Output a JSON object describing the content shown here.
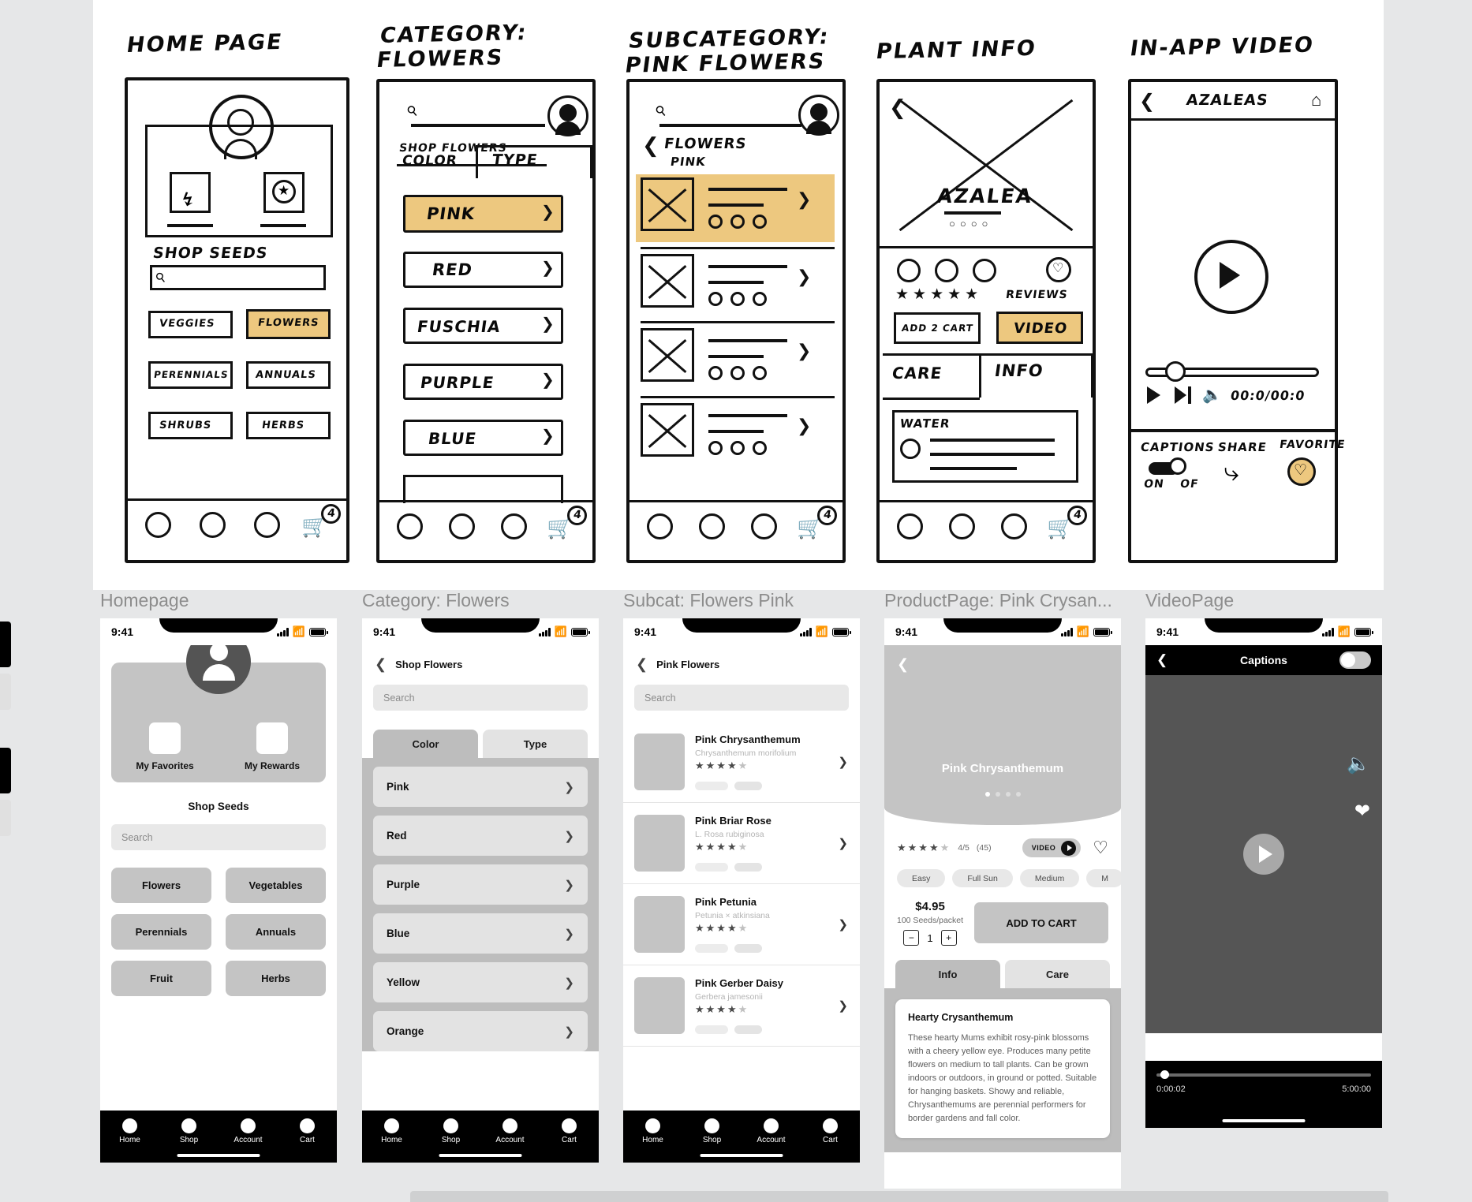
{
  "sketches": [
    {
      "title": "HOME PAGE",
      "labels": [
        "SHOP SEEDS",
        "VEGGIES",
        "FLOWERS",
        "PERENNIALS",
        "ANNUALS",
        "SHRUBS",
        "HERBS"
      ],
      "highlighted": "FLOWERS",
      "cart_badge": "4"
    },
    {
      "title": "CATEGORY:\nFLOWERS",
      "labels": [
        "SHOP FLOWERS",
        "COLOR",
        "TYPE",
        "PINK",
        "RED",
        "FUSCHIA",
        "PURPLE",
        "BLUE"
      ],
      "highlighted": "PINK",
      "cart_badge": "4"
    },
    {
      "title": "SUBCATEGORY:\nPINK FLOWERS",
      "labels": [
        "FLOWERS",
        "PINK"
      ],
      "cart_badge": "4"
    },
    {
      "title": "PLANT INFO",
      "labels": [
        "AZALEA",
        "REVIEWS",
        "ADD 2 CART",
        "VIDEO",
        "CARE",
        "INFO",
        "WATER"
      ],
      "highlighted": "VIDEO",
      "cart_badge": "4"
    },
    {
      "title": "IN-APP VIDEO",
      "labels": [
        "AZALEAS",
        "00:0/00:0",
        "CAPTIONS",
        "ON",
        "OF",
        "SHARE",
        "FAVORITE"
      ]
    }
  ],
  "sketch_text": {
    "home_shop_seeds": "SHOP SEEDS",
    "home_veggies": "VEGGIES",
    "home_flowers": "FLOWERS",
    "home_perennials": "PERENNIALS",
    "home_annuals": "ANNUALS",
    "home_shrubs": "SHRUBS",
    "home_herbs": "HERBS",
    "cat_shop_flowers": "SHOP FLOWERS",
    "cat_color": "COLOR",
    "cat_type": "TYPE",
    "cat_pink": "PINK",
    "cat_red": "RED",
    "cat_fuschia": "FUSCHIA",
    "cat_purple": "PURPLE",
    "cat_blue": "BLUE",
    "sub_flowers": "FLOWERS",
    "sub_pink": "PINK",
    "plant_name": "AZALEA",
    "plant_reviews": "REVIEWS",
    "plant_add_cart": "ADD 2 CART",
    "plant_video": "VIDEO",
    "plant_care": "CARE",
    "plant_info": "INFO",
    "plant_water": "WATER",
    "video_title": "AZALEAS",
    "video_time": "00:0/00:0",
    "video_captions": "CAPTIONS",
    "video_on": "ON",
    "video_of": "OF",
    "video_share": "SHARE",
    "video_favorite": "FAVORITE",
    "cart_badge": "4"
  },
  "mockups": [
    {
      "label": "Homepage",
      "status": {
        "time": "9:41"
      },
      "hero": {
        "tiles": [
          {
            "label": "My Favorites"
          },
          {
            "label": "My Rewards"
          }
        ]
      },
      "section_title": "Shop Seeds",
      "search_placeholder": "Search",
      "categories": [
        "Flowers",
        "Vegetables",
        "Perennials",
        "Annuals",
        "Fruit",
        "Herbs"
      ],
      "tabs": [
        "Home",
        "Shop",
        "Account",
        "Cart"
      ]
    },
    {
      "label": "Category: Flowers",
      "status": {
        "time": "9:41"
      },
      "nav_title": "Shop Flowers",
      "search_placeholder": "Search",
      "segments": [
        {
          "label": "Color",
          "active": true
        },
        {
          "label": "Type",
          "active": false
        }
      ],
      "colors": [
        "Pink",
        "Red",
        "Purple",
        "Blue",
        "Yellow",
        "Orange"
      ],
      "tabs": [
        "Home",
        "Shop",
        "Account",
        "Cart"
      ]
    },
    {
      "label": "Subcat: Flowers Pink",
      "status": {
        "time": "9:41"
      },
      "nav_title": "Pink Flowers",
      "search_placeholder": "Search",
      "plants": [
        {
          "name": "Pink Chrysanthemum",
          "scientific": "Chrysanthemum morifolium",
          "rating": 4
        },
        {
          "name": "Pink Briar Rose",
          "scientific": "L. Rosa rubiginosa",
          "rating": 4
        },
        {
          "name": "Pink Petunia",
          "scientific": "Petunia × atkinsiana",
          "rating": 4
        },
        {
          "name": "Pink Gerber Daisy",
          "scientific": "Gerbera jamesonii",
          "rating": 4
        }
      ],
      "tabs": [
        "Home",
        "Shop",
        "Account",
        "Cart"
      ]
    },
    {
      "label": "ProductPage: Pink Crysan...",
      "status": {
        "time": "9:41"
      },
      "product_title": "Pink Chrysanthemum",
      "rating_stars": 4,
      "rating_text": "4/5",
      "review_count": "(45)",
      "video_chip": "VIDEO",
      "tags": [
        "Easy",
        "Full Sun",
        "Medium",
        "M"
      ],
      "price": "$4.95",
      "price_sub": "100 Seeds/packet",
      "quantity": "1",
      "add_to_cart": "ADD TO CART",
      "tabs_detail": [
        {
          "label": "Info",
          "active": true
        },
        {
          "label": "Care",
          "active": false
        }
      ],
      "info_card": {
        "heading": "Hearty Crysanthemum",
        "body": "These hearty Mums exhibit rosy-pink blossoms with a cheery yellow eye. Produces many petite flowers on medium to tall plants. Can be grown indoors or outdoors, in ground or potted. Suitable for hanging baskets. Showy and reliable, Chrysanthemums are perennial performers for border gardens and fall color."
      }
    },
    {
      "label": "VideoPage",
      "status": {
        "time": "9:41"
      },
      "captions_label": "Captions",
      "time_current": "0:00:02",
      "time_total": "5:00:00"
    }
  ]
}
